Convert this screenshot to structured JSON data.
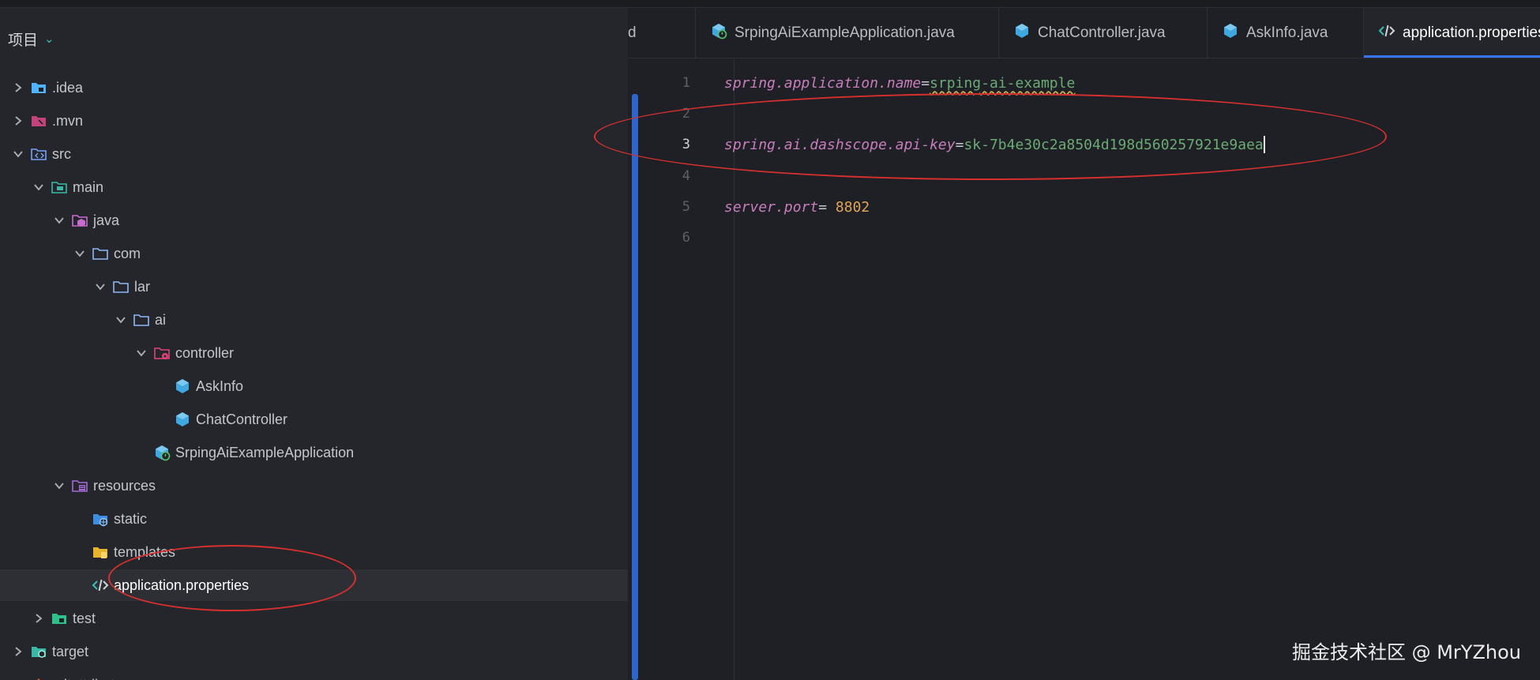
{
  "project_panel": {
    "title": "项目",
    "tree": [
      {
        "label": ".idea",
        "depth": 1,
        "arrow": "right",
        "icon": "folder-idea-icon",
        "color": "#4fb3ff"
      },
      {
        "label": ".mvn",
        "depth": 1,
        "arrow": "right",
        "icon": "folder-mvn-icon",
        "color": "#c2447a"
      },
      {
        "label": "src",
        "depth": 1,
        "arrow": "down",
        "icon": "folder-source-icon",
        "color": "#7aa2f7"
      },
      {
        "label": "main",
        "depth": 2,
        "arrow": "down",
        "icon": "folder-main-icon",
        "color": "#3ab8a5"
      },
      {
        "label": "java",
        "depth": 3,
        "arrow": "down",
        "icon": "folder-java-icon",
        "color": "#c86cd0"
      },
      {
        "label": "com",
        "depth": 4,
        "arrow": "down",
        "icon": "folder-icon",
        "color": "#8fb7f5"
      },
      {
        "label": "lar",
        "depth": 5,
        "arrow": "down",
        "icon": "folder-icon",
        "color": "#8fb7f5"
      },
      {
        "label": "ai",
        "depth": 6,
        "arrow": "down",
        "icon": "folder-icon",
        "color": "#8fb7f5"
      },
      {
        "label": "controller",
        "depth": 7,
        "arrow": "down",
        "icon": "folder-controller-icon",
        "color": "#e0457a"
      },
      {
        "label": "AskInfo",
        "depth": 8,
        "arrow": "none",
        "icon": "java-class-icon",
        "color": "#3fa8e0"
      },
      {
        "label": "ChatController",
        "depth": 8,
        "arrow": "none",
        "icon": "java-class-icon",
        "color": "#3fa8e0"
      },
      {
        "label": "SrpingAiExampleApplication",
        "depth": 7,
        "arrow": "none",
        "icon": "spring-app-class-icon",
        "color": "#3fa8e0"
      },
      {
        "label": "resources",
        "depth": 3,
        "arrow": "down",
        "icon": "folder-resources-icon",
        "color": "#a56ad6"
      },
      {
        "label": "static",
        "depth": 4,
        "arrow": "none",
        "icon": "folder-web-icon",
        "color": "#3f8de0"
      },
      {
        "label": "templates",
        "depth": 4,
        "arrow": "none",
        "icon": "folder-templates-icon",
        "color": "#e6b52e"
      },
      {
        "label": "application.properties",
        "depth": 4,
        "arrow": "none",
        "icon": "properties-file-icon",
        "color": "#cfd3da",
        "selected": true
      },
      {
        "label": "test",
        "depth": 2,
        "arrow": "right",
        "icon": "folder-test-icon",
        "color": "#2fbf8a"
      },
      {
        "label": "target",
        "depth": 1,
        "arrow": "right",
        "icon": "folder-target-icon",
        "color": "#3ab8a5"
      },
      {
        "label": ".gitattributes",
        "depth": 1,
        "arrow": "none",
        "icon": "git-file-icon",
        "color": "#e0503a"
      }
    ]
  },
  "editor": {
    "tabs": [
      {
        "label": "d",
        "icon": "none"
      },
      {
        "label": "SrpingAiExampleApplication.java",
        "icon": "spring-app-class-icon"
      },
      {
        "label": "ChatController.java",
        "icon": "java-class-icon"
      },
      {
        "label": "AskInfo.java",
        "icon": "java-class-icon"
      },
      {
        "label": "application.properties",
        "icon": "properties-file-icon",
        "active": true
      }
    ],
    "line_numbers": [
      "1",
      "2",
      "3",
      "4",
      "5",
      "6"
    ],
    "current_line": "3",
    "code": {
      "line1": {
        "key": "spring.application.name",
        "eq": "=",
        "value": "srping-ai-example"
      },
      "line3": {
        "key": "spring.ai.dashscope.api-key",
        "eq": "=",
        "value": "sk-7b4e30c2a8504d198d560257921e9aea"
      },
      "line5": {
        "key": "server.port",
        "eq": "= ",
        "value": "8802"
      }
    }
  },
  "watermark": "掘金技术社区 @ MrYZhou",
  "colors": {
    "annotation": "#d6302e",
    "accent": "#3574f0",
    "key": "#c77dbb",
    "value": "#6aab73",
    "number": "#e0a45a"
  }
}
